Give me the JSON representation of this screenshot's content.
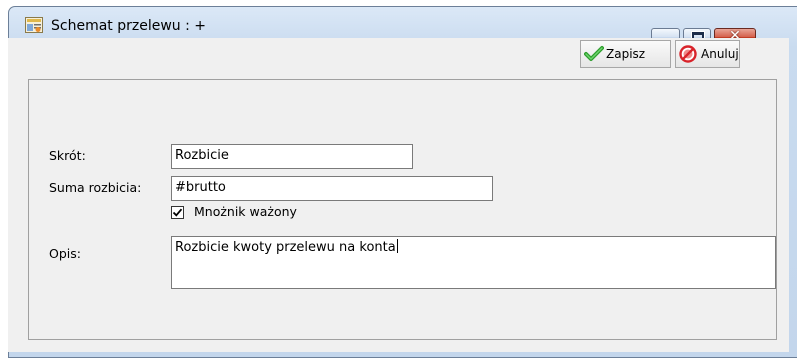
{
  "window": {
    "title": "Schemat przelewu : +",
    "icons": {
      "app": "form-document-icon",
      "minimize": "minimize-icon",
      "maximize": "maximize-icon",
      "close": "close-icon"
    },
    "close_glyph": "✕"
  },
  "toolbar": {
    "save_label": "Zapisz",
    "save_icon": "green-checkmark-icon",
    "cancel_label": "Anuluj",
    "cancel_icon": "cancel-circle-icon"
  },
  "form": {
    "skrot": {
      "label": "Skrót:",
      "value": "Rozbicie"
    },
    "suma_rozbicia": {
      "label": "Suma rozbicia:",
      "value": "#brutto"
    },
    "mnoznik_wazony": {
      "label": "Mnożnik ważony",
      "checked": true
    },
    "opis": {
      "label": "Opis:",
      "value": "Rozbicie kwoty przelewu na konta"
    }
  },
  "colors": {
    "titlebar": "#c9dbef",
    "client": "#f0f0f0",
    "close_button": "#c13b22",
    "save_check": "#2e9e2e",
    "cancel_red": "#d8232a"
  }
}
